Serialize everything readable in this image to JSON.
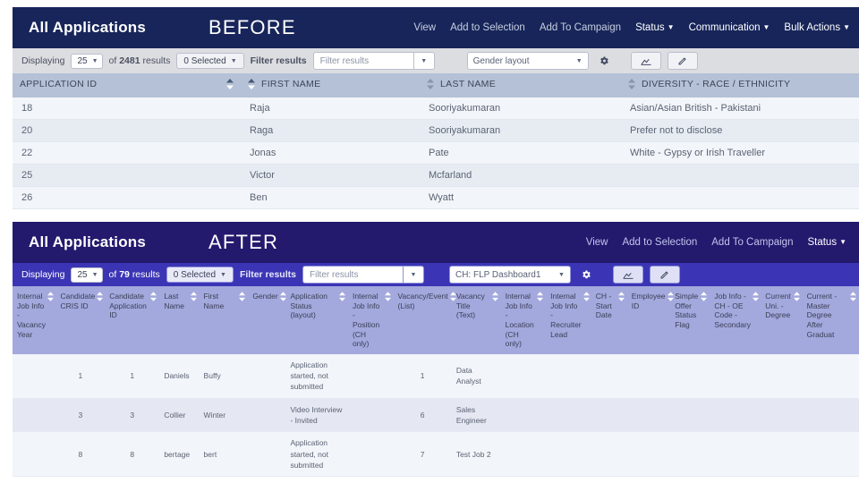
{
  "before": {
    "title": "All Applications",
    "badge": "BEFORE",
    "menu": [
      {
        "label": "View",
        "caret": false,
        "strong": false
      },
      {
        "label": "Add to Selection",
        "caret": false,
        "strong": false
      },
      {
        "label": "Add To Campaign",
        "caret": false,
        "strong": false
      },
      {
        "label": "Status",
        "caret": true,
        "strong": true
      },
      {
        "label": "Communication",
        "caret": true,
        "strong": true
      },
      {
        "label": "Bulk Actions",
        "caret": true,
        "strong": true
      }
    ],
    "toolbar": {
      "displaying_label": "Displaying",
      "page_size": "25",
      "of_label": "of",
      "results_count": "2481",
      "results_label": "results",
      "selected_label": "0 Selected",
      "filter_label": "Filter results",
      "filter_placeholder": "Filter results",
      "layout_value": "Gender layout",
      "gear_icon": "gear-icon",
      "save_icon": "save-layout-icon",
      "edit_icon": "edit-layout-icon"
    },
    "columns": [
      {
        "label": "APPLICATION ID",
        "sort": "asc"
      },
      {
        "label": "FIRST NAME",
        "sort": "asc"
      },
      {
        "label": "LAST NAME",
        "sort": "none"
      },
      {
        "label": "DIVERSITY - RACE / ETHNICITY",
        "sort": "none"
      }
    ],
    "rows": [
      [
        "18",
        "Raja",
        "Sooriyakumaran",
        "Asian/Asian British - Pakistani"
      ],
      [
        "20",
        "Raga",
        "Sooriyakumaran",
        "Prefer not to disclose"
      ],
      [
        "22",
        "Jonas",
        "Pate",
        "White - Gypsy or Irish Traveller"
      ],
      [
        "25",
        "Victor",
        "Mcfarland",
        ""
      ],
      [
        "26",
        "Ben",
        "Wyatt",
        ""
      ]
    ]
  },
  "after": {
    "title": "All Applications",
    "badge": "AFTER",
    "menu": [
      {
        "label": "View",
        "caret": false,
        "strong": false
      },
      {
        "label": "Add to Selection",
        "caret": false,
        "strong": false
      },
      {
        "label": "Add To Campaign",
        "caret": false,
        "strong": false
      },
      {
        "label": "Status",
        "caret": true,
        "strong": true
      }
    ],
    "toolbar": {
      "displaying_label": "Displaying",
      "page_size": "25",
      "of_label": "of",
      "results_count": "79",
      "results_label": "results",
      "selected_label": "0 Selected",
      "filter_label": "Filter results",
      "filter_placeholder": "Filter results",
      "layout_value": "CH: FLP Dashboard1",
      "gear_icon": "gear-icon",
      "save_icon": "save-layout-icon",
      "edit_icon": "edit-layout-icon"
    },
    "columns": [
      {
        "label": "Internal Job Info - Vacancy Year",
        "sort": "none"
      },
      {
        "label": "Candidate CRIS ID",
        "sort": "none"
      },
      {
        "label": "Candidate Application ID",
        "sort": "none"
      },
      {
        "label": "Last Name",
        "sort": "none"
      },
      {
        "label": "First Name",
        "sort": "none"
      },
      {
        "label": "Gender",
        "sort": "none"
      },
      {
        "label": "Application Status (layout)",
        "sort": "none"
      },
      {
        "label": "Internal Job Info - Position (CH only)",
        "sort": "none"
      },
      {
        "label": "Vacancy/Event (List)",
        "sort": "none"
      },
      {
        "label": "Vacancy Title (Text)",
        "sort": "none"
      },
      {
        "label": "Internal Job Info - Location (CH only)",
        "sort": "none"
      },
      {
        "label": "Internal Job Info - Recruiter Lead",
        "sort": "none"
      },
      {
        "label": "CH - Start Date",
        "sort": "none"
      },
      {
        "label": "Employee ID",
        "sort": "none"
      },
      {
        "label": "Simple Offer Status Flag",
        "sort": "none"
      },
      {
        "label": "Job Info - CH - OE Code - Secondary",
        "sort": "none"
      },
      {
        "label": "Current Uni. - Degree",
        "sort": "none"
      },
      {
        "label": "Current - Master Degree After Graduat",
        "sort": "none"
      }
    ],
    "rows": [
      [
        "",
        "1",
        "1",
        "Daniels",
        "Buffy",
        "",
        "Application started, not submitted",
        "",
        "1",
        "Data Analyst",
        "",
        "",
        "",
        "",
        "",
        "",
        "",
        ""
      ],
      [
        "",
        "3",
        "3",
        "Collier",
        "Winter",
        "",
        "Video Interview - Invited",
        "",
        "6",
        "Sales Engineer",
        "",
        "",
        "",
        "",
        "",
        "",
        "",
        ""
      ],
      [
        "",
        "8",
        "8",
        "bertage",
        "bert",
        "",
        "Application started, not submitted",
        "",
        "7",
        "Test Job 2",
        "",
        "",
        "",
        "",
        "",
        "",
        "",
        ""
      ]
    ]
  },
  "colors": {
    "before_header": "#17255a",
    "before_toolbar": "#dcdde1",
    "before_thead": "#b4c1d6",
    "after_header": "#231a6e",
    "after_toolbar": "#3b35b5",
    "after_thead": "#a3a8dd",
    "row_odd": "#f2f5f9",
    "row_even_before": "#e7ecf3",
    "row_even_after": "#e5e7f2"
  }
}
